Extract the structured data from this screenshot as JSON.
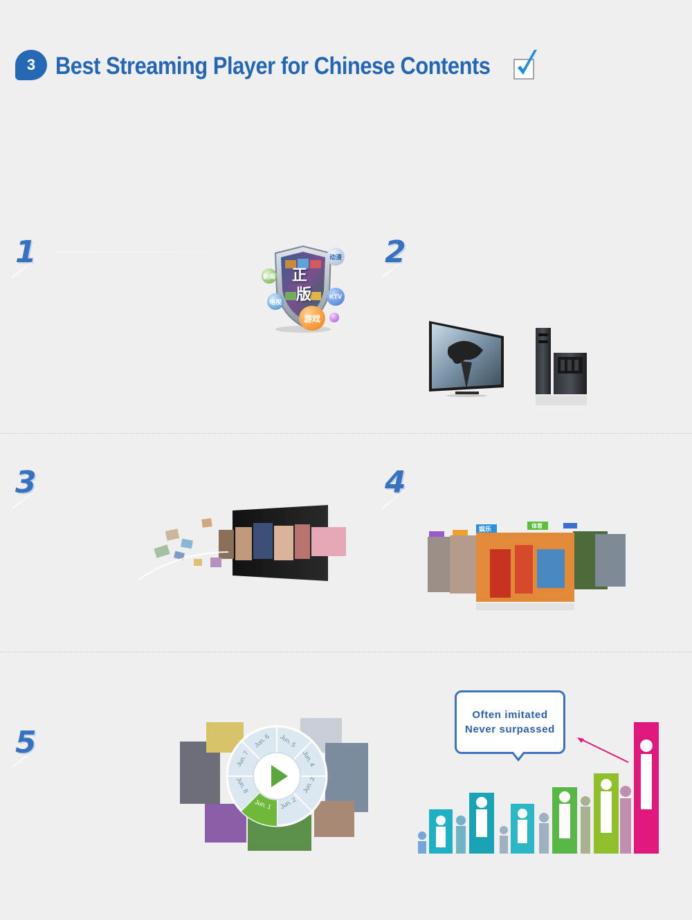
{
  "header": {
    "badge_number": "3",
    "title": "Best Streaming Player for Chinese Contents"
  },
  "sections": {
    "s1": {
      "number": "1"
    },
    "s2": {
      "number": "2"
    },
    "s3": {
      "number": "3"
    },
    "s4": {
      "number": "4"
    },
    "s5": {
      "number": "5"
    }
  },
  "shield": {
    "main_chars": [
      "正",
      "版"
    ],
    "bubbles": [
      "动漫",
      "KTV",
      "游戏",
      "电视",
      "新闻"
    ]
  },
  "panel4_tabs": [
    "娱乐",
    "体育"
  ],
  "wheel": {
    "segments": [
      "Jun. 6",
      "Jun. 5",
      "Jun. 4",
      "Jun. 3",
      "Jun. 2",
      "Jun. 1",
      "Jun. 8",
      "Jun. 7"
    ],
    "selected": "Jun. 1"
  },
  "speech": {
    "line1": "Often imitated",
    "line2": "Never surpassed"
  },
  "colors": {
    "brand_blue": "#2466b6",
    "bar_teal": "#1aa7b8",
    "bar_green": "#8fbf2a",
    "bar_pink": "#e0187c"
  }
}
